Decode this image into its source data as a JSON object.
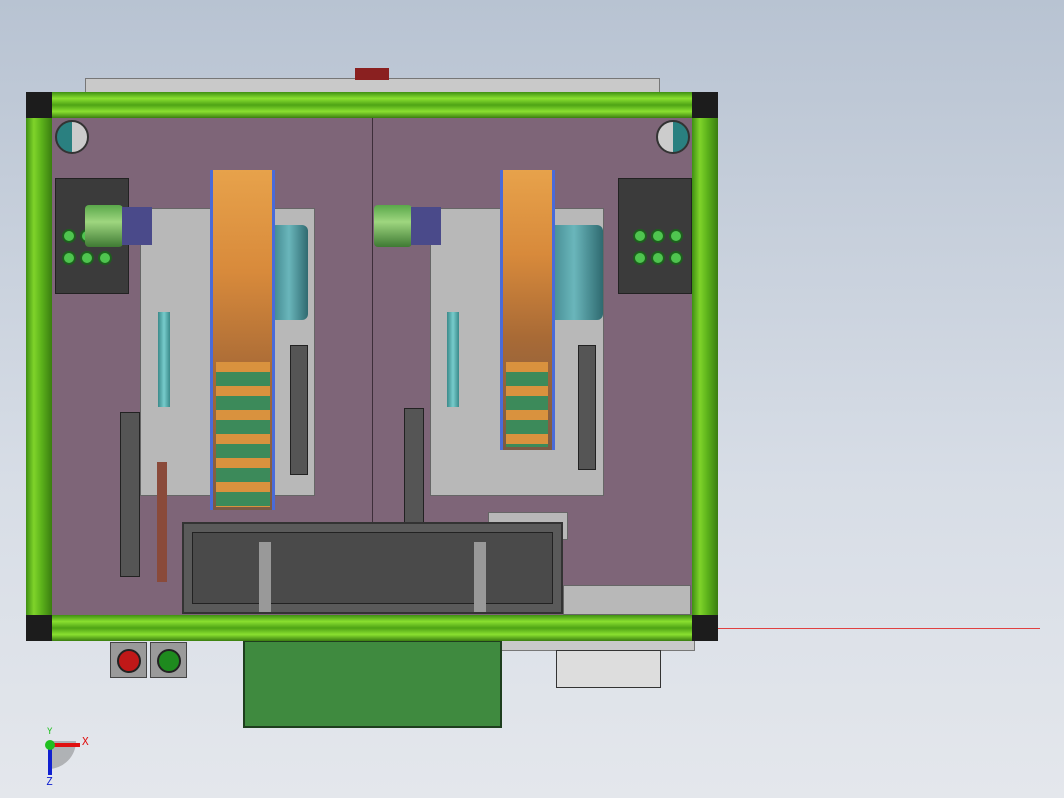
{
  "viewport": {
    "type": "CAD model view"
  },
  "triad": {
    "x_label": "X",
    "y_label": "Y",
    "z_label": "Z"
  },
  "colors": {
    "frame": "#6cc322",
    "panel": "#7e6578",
    "stop_button": "#c01818",
    "start_button": "#1e8a1e",
    "axis_x": "#e01010",
    "axis_y": "#20c020",
    "axis_z": "#1020d0"
  }
}
